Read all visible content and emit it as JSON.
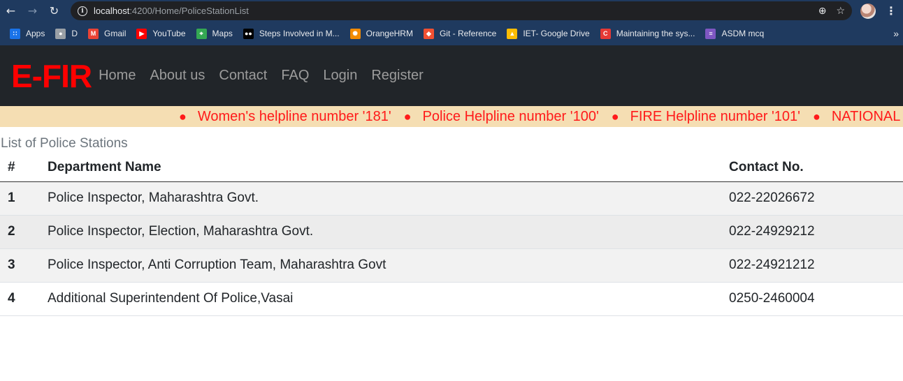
{
  "browser": {
    "url_host": "localhost",
    "url_rest": ":4200/Home/PoliceStationList",
    "bookmarks": [
      {
        "label": "Apps",
        "icon": "apps-grid-icon",
        "color": "#1a73e8"
      },
      {
        "label": "D",
        "icon": "globe-icon",
        "color": "#9aa0a6"
      },
      {
        "label": "Gmail",
        "icon": "gmail-icon",
        "color": "#ea4335"
      },
      {
        "label": "YouTube",
        "icon": "youtube-icon",
        "color": "#ff0000"
      },
      {
        "label": "Maps",
        "icon": "maps-icon",
        "color": "#34a853"
      },
      {
        "label": "Steps Involved in M...",
        "icon": "medium-icon",
        "color": "#000000"
      },
      {
        "label": "OrangeHRM",
        "icon": "orangehrm-icon",
        "color": "#f28b00"
      },
      {
        "label": "Git - Reference",
        "icon": "git-icon",
        "color": "#f05032"
      },
      {
        "label": "IET- Google Drive",
        "icon": "google-drive-icon",
        "color": "#fbbc04"
      },
      {
        "label": "Maintaining the sys...",
        "icon": "c-icon",
        "color": "#e53935"
      },
      {
        "label": "ASDM mcq",
        "icon": "forms-icon",
        "color": "#7e57c2"
      }
    ]
  },
  "header": {
    "brand": "E-FIR",
    "menu": [
      "Home",
      "About us",
      "Contact",
      "FAQ",
      "Login",
      "Register"
    ]
  },
  "ticker": {
    "items": [
      "Women's helpline number '181'",
      "Police Helpline number '100'",
      "FIRE Helpline number '101'",
      "NATIONAL EM"
    ],
    "colors": {
      "background": "#f5deb3",
      "text": "#ff1a1a"
    }
  },
  "main": {
    "title": "List of Police Stations",
    "columns": [
      "#",
      "Department Name",
      "Contact No."
    ],
    "rows": [
      {
        "num": "1",
        "name": "Police Inspector, Maharashtra Govt.",
        "contact": "022-22026672"
      },
      {
        "num": "2",
        "name": "Police Inspector, Election, Maharashtra Govt.",
        "contact": "022-24929212"
      },
      {
        "num": "3",
        "name": "Police Inspector, Anti Corruption Team, Maharashtra Govt",
        "contact": "022-24921212"
      },
      {
        "num": "4",
        "name": "Additional Superintendent Of Police,Vasai",
        "contact": "0250-2460004"
      }
    ]
  }
}
